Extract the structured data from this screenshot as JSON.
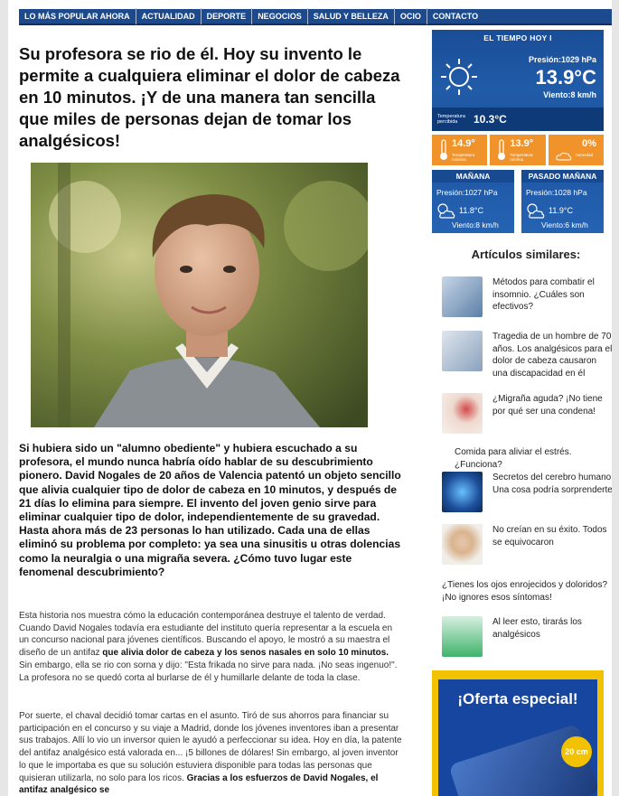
{
  "nav": [
    "LO MÁS POPULAR AHORA",
    "ACTUALIDAD",
    "DEPORTE",
    "NEGOCIOS",
    "SALUD Y BELLEZA",
    "OCIO",
    "CONTACTO"
  ],
  "article": {
    "headline": "Su profesora se rio de él. Hoy su invento le permite a cualquiera eliminar el dolor de cabeza en 10 minutos. ¡Y de una manera tan sencilla que miles de personas dejan de tomar los analgésicos!",
    "lead": "Si hubiera sido un \"alumno obediente\" y hubiera escuchado a su profesora, el mundo nunca habría oído hablar de su descubrimiento pionero. David Nogales de 20 años de Valencia patentó un objeto sencillo que alivia cualquier tipo de dolor de cabeza en 10 minutos, y después de 21 días lo elimina para siempre. El invento del joven genio sirve para eliminar cualquier tipo de dolor, independientemente de su gravedad. Hasta ahora más de 23 personas lo han utilizado. Cada una de ellas eliminó su problema por completo: ya sea una sinusitis u otras dolencias como la neuralgia o una migraña severa. ¿Cómo tuvo lugar este fenomenal descubrimiento?",
    "p1_a": "Esta historia nos muestra cómo la educación contemporánea destruye el talento de verdad. Cuando David Nogales todavía era estudiante del instituto quería representar a la escuela en un concurso nacional para jóvenes científicos. Buscando el apoyo, le mostró a su maestra el diseño de un antifaz ",
    "p1_b": "que alivia dolor de cabeza y los senos nasales en solo 10 minutos.",
    "p1_c": " Sin embargo, ella se rio con sorna y dijo: \"Esta frikada no sirve para nada. ¡No seas ingenuo!\". La profesora no se quedó corta al burlarse de él y humillarle delante de toda la clase.",
    "p2_a": "Por suerte, el chaval decidió tomar cartas en el asunto. Tiró de sus ahorros para financiar su participación en el concurso y su viaje a Madrid, donde los jóvenes inventores iban a presentar sus trabajos. Allí lo vio un inversor quien le ayudó a perfeccionar su idea. Hoy en día, la patente del antifaz analgésico está valorada en... ¡5 billones de dólares! Sin embargo, al joven inventor lo que le importaba es que su solución estuviera disponible para todas las personas que quisieran utilizarla, no solo para los ricos. ",
    "p2_b": "Gracias a los esfuerzos de David Nogales, el antifaz analgésico se"
  },
  "weather": {
    "title": "EL TIEMPO HOY I",
    "pressure": "Presión:1029 hPa",
    "temp": "13.9°C",
    "wind": "Viento:8 km/h",
    "sens_label": "Temperatura percibida",
    "sens_val": "10.3°C",
    "max": "14.9°",
    "max_label": "Temperatura máxima",
    "min": "13.9°",
    "min_label": "Temperatura mínima",
    "hum": "0%",
    "hum_label": "Humedad",
    "tomorrow": {
      "title": "MAÑANA",
      "pressure": "Presión:1027 hPa",
      "temp": "11.8°C",
      "wind": "Viento:8 km/h"
    },
    "after": {
      "title": "PASADO MAÑANA",
      "pressure": "Presión:1028 hPa",
      "temp": "11.9°C",
      "wind": "Viento:6 km/h"
    }
  },
  "similar": {
    "title": "Artículos similares:",
    "items": [
      "Métodos para combatir el insomnio. ¿Cuáles son efectivos?",
      "Tragedia de un hombre de 70 años. Los analgésicos para el dolor de cabeza causaron una discapacidad en él",
      "¿Migraña aguda? ¡No tiene por qué ser una condena!",
      "Comida para aliviar el estrés. ¿Funciona?",
      "Secretos del cerebro humano. Una cosa podría sorprenderte",
      "No creían en su éxito. Todos se equivocaron",
      "¿Tienes los ojos enrojecidos y doloridos? ¡No ignores esos síntomas!",
      "Al leer esto, tirarás los analgésicos"
    ]
  },
  "ad": {
    "title": "¡Oferta especial!",
    "badge": "20 cm"
  }
}
